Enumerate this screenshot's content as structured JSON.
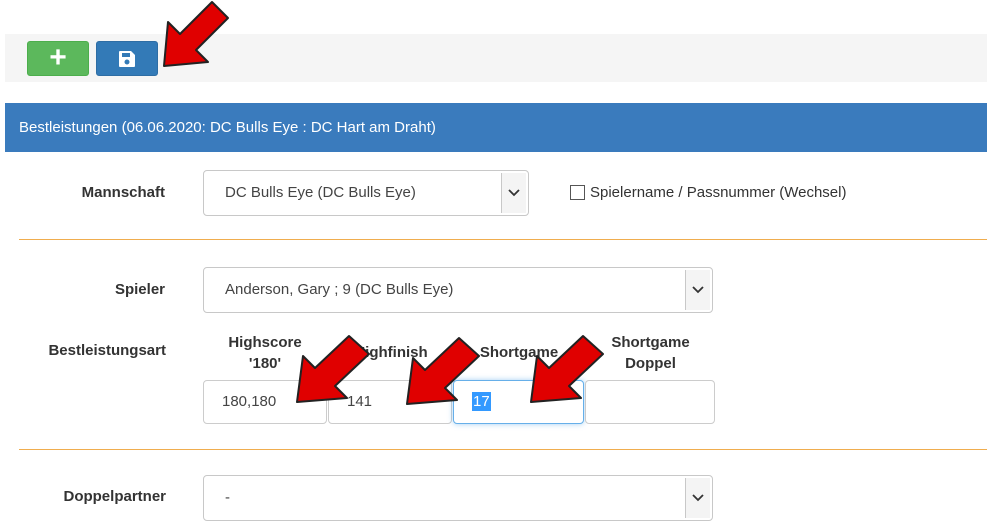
{
  "toolbar": {
    "add_icon": "plus-icon",
    "save_icon": "floppy-disk-icon",
    "add_color": "#5cb85c",
    "save_color": "#337ab7"
  },
  "panel": {
    "title": "Bestleistungen (06.06.2020: DC Bulls Eye : DC Hart am Draht)",
    "color": "#3a7bbd"
  },
  "form": {
    "mannschaft": {
      "label": "Mannschaft",
      "value": "DC Bulls Eye (DC Bulls Eye)"
    },
    "wechsel": {
      "label": "Spielername / Passnummer (Wechsel)",
      "checked": false
    },
    "spieler": {
      "label": "Spieler",
      "value": "Anderson, Gary ; 9 (DC Bulls Eye)"
    },
    "bestleistungsart": {
      "label": "Bestleistungsart",
      "columns": [
        {
          "head_line1": "Highscore",
          "head_line2": "'180'",
          "value": "180,180"
        },
        {
          "head_line1": "Highfinish",
          "head_line2": "",
          "value": "141"
        },
        {
          "head_line1": "Shortgame",
          "head_line2": "",
          "value": "17"
        },
        {
          "head_line1": "Shortgame",
          "head_line2": "Doppel",
          "value": ""
        }
      ]
    },
    "doppelpartner": {
      "label": "Doppelpartner",
      "value": "-"
    }
  },
  "annotations": {
    "arrow_color": "#e00000",
    "arrow_icon": "red-arrow-icon"
  }
}
